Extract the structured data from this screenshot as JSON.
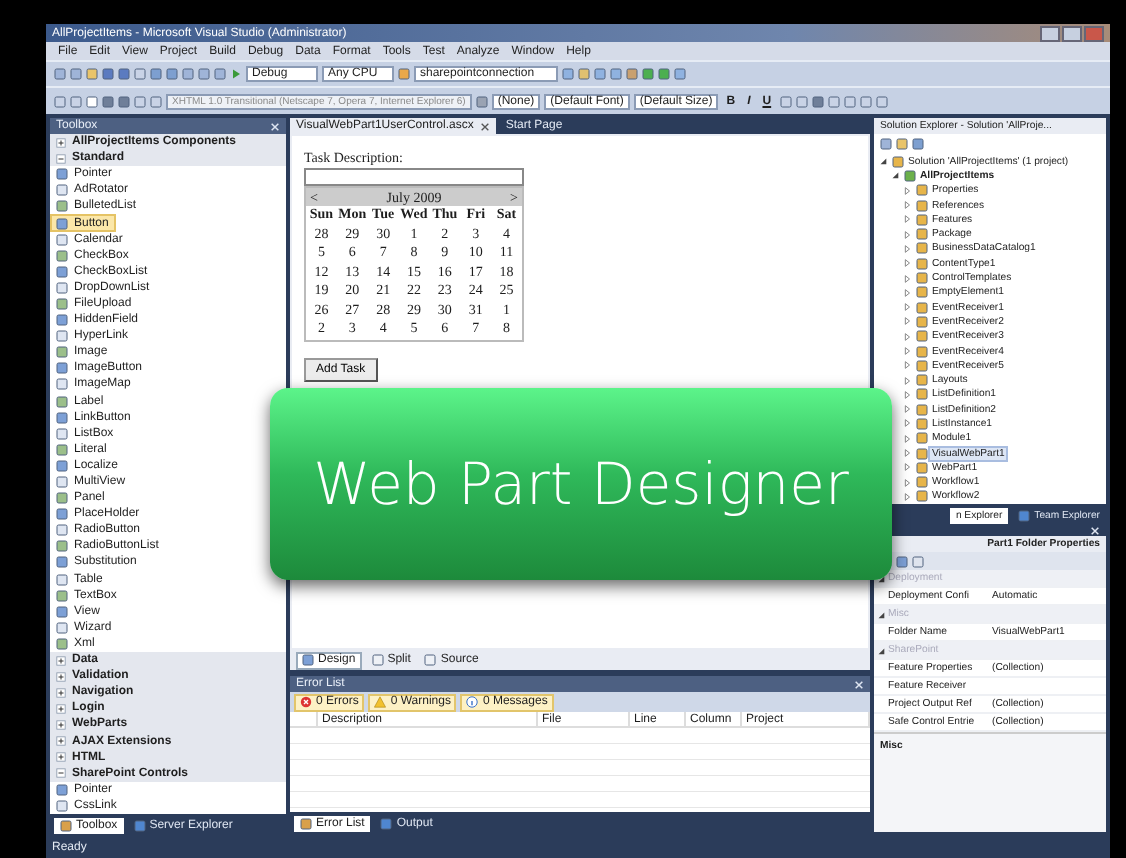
{
  "window": {
    "title": "AllProjectItems - Microsoft Visual Studio (Administrator)"
  },
  "menu": [
    "File",
    "Edit",
    "View",
    "Project",
    "Build",
    "Debug",
    "Data",
    "Format",
    "Tools",
    "Test",
    "Analyze",
    "Window",
    "Help"
  ],
  "toolbar": {
    "combos": [
      "Debug",
      "Any CPU",
      "sharepointconnection"
    ]
  },
  "format_toolbar": {
    "doctype": "XHTML 1.0 Transitional (Netscape 7, Opera 7, Internet Explorer 6)",
    "combos": [
      "(None)",
      "(Default Font)",
      "(Default Size)"
    ],
    "buttons": [
      "B",
      "I",
      "U"
    ]
  },
  "toolbox": {
    "title": "Toolbox",
    "groups": [
      {
        "label": "AllProjectItems Components",
        "expanded": false
      },
      {
        "label": "Standard",
        "expanded": true,
        "items": [
          {
            "label": "Pointer",
            "selected": false
          },
          {
            "label": "AdRotator",
            "selected": false
          },
          {
            "label": "BulletedList",
            "selected": false
          },
          {
            "label": "Button",
            "selected": true
          },
          {
            "label": "Calendar",
            "selected": false
          },
          {
            "label": "CheckBox",
            "selected": false
          },
          {
            "label": "CheckBoxList",
            "selected": false
          },
          {
            "label": "DropDownList",
            "selected": false
          },
          {
            "label": "FileUpload",
            "selected": false
          },
          {
            "label": "HiddenField",
            "selected": false
          },
          {
            "label": "HyperLink",
            "selected": false
          },
          {
            "label": "Image",
            "selected": false
          },
          {
            "label": "ImageButton",
            "selected": false
          },
          {
            "label": "ImageMap",
            "selected": false
          },
          {
            "label": "Label",
            "selected": false
          },
          {
            "label": "LinkButton",
            "selected": false
          },
          {
            "label": "ListBox",
            "selected": false
          },
          {
            "label": "Literal",
            "selected": false
          },
          {
            "label": "Localize",
            "selected": false
          },
          {
            "label": "MultiView",
            "selected": false
          },
          {
            "label": "Panel",
            "selected": false
          },
          {
            "label": "PlaceHolder",
            "selected": false
          },
          {
            "label": "RadioButton",
            "selected": false
          },
          {
            "label": "RadioButtonList",
            "selected": false
          },
          {
            "label": "Substitution",
            "selected": false
          },
          {
            "label": "Table",
            "selected": false
          },
          {
            "label": "TextBox",
            "selected": false
          },
          {
            "label": "View",
            "selected": false
          },
          {
            "label": "Wizard",
            "selected": false
          },
          {
            "label": "Xml",
            "selected": false
          }
        ]
      },
      {
        "label": "Data",
        "expanded": false
      },
      {
        "label": "Validation",
        "expanded": false
      },
      {
        "label": "Navigation",
        "expanded": false
      },
      {
        "label": "Login",
        "expanded": false
      },
      {
        "label": "WebParts",
        "expanded": false
      },
      {
        "label": "AJAX Extensions",
        "expanded": false
      },
      {
        "label": "HTML",
        "expanded": false
      },
      {
        "label": "SharePoint Controls",
        "expanded": true,
        "items": [
          {
            "label": "Pointer",
            "selected": false
          },
          {
            "label": "CssLink",
            "selected": false
          }
        ]
      }
    ],
    "tabs": [
      {
        "label": "Toolbox",
        "selected": true
      },
      {
        "label": "Server Explorer",
        "selected": false
      }
    ]
  },
  "document_tabs": [
    {
      "label": "VisualWebPart1UserControl.ascx",
      "selected": true
    },
    {
      "label": "Start Page",
      "selected": false
    }
  ],
  "designer": {
    "label": "Task Description:",
    "calendar": {
      "prev": "<",
      "month": "July 2009",
      "next": ">",
      "weekdays": [
        "Sun",
        "Mon",
        "Tue",
        "Wed",
        "Thu",
        "Fri",
        "Sat"
      ],
      "weeks": [
        [
          "28",
          "29",
          "30",
          "1",
          "2",
          "3",
          "4"
        ],
        [
          "5",
          "6",
          "7",
          "8",
          "9",
          "10",
          "11"
        ],
        [
          "12",
          "13",
          "14",
          "15",
          "16",
          "17",
          "18"
        ],
        [
          "19",
          "20",
          "21",
          "22",
          "23",
          "24",
          "25"
        ],
        [
          "26",
          "27",
          "28",
          "29",
          "30",
          "31",
          "1"
        ],
        [
          "2",
          "3",
          "4",
          "5",
          "6",
          "7",
          "8"
        ]
      ]
    },
    "button": "Add Task"
  },
  "view_tabs": [
    {
      "label": "Design",
      "selected": true
    },
    {
      "label": "Split",
      "selected": false
    },
    {
      "label": "Source",
      "selected": false
    }
  ],
  "error_list": {
    "title": "Error List",
    "filters": [
      {
        "kind": "error",
        "label": "0 Errors"
      },
      {
        "kind": "warning",
        "label": "0 Warnings"
      },
      {
        "kind": "info",
        "label": "0 Messages"
      }
    ],
    "columns": [
      "Description",
      "File",
      "Line",
      "Column",
      "Project"
    ],
    "tabs": [
      {
        "label": "Error List",
        "selected": true
      },
      {
        "label": "Output",
        "selected": false
      }
    ]
  },
  "solution_explorer": {
    "title": "Solution Explorer - Solution 'AllProje...",
    "tree": [
      {
        "label": "Solution 'AllProjectItems' (1 project)",
        "selected": false,
        "expanded": true,
        "children": [
          {
            "label": "AllProjectItems",
            "selected": false,
            "expanded": true,
            "children": [
              {
                "label": "Properties",
                "selected": false,
                "expanded": false
              },
              {
                "label": "References",
                "selected": false,
                "expanded": false
              },
              {
                "label": "Features",
                "selected": false,
                "expanded": false
              },
              {
                "label": "Package",
                "selected": false,
                "expanded": false
              },
              {
                "label": "BusinessDataCatalog1",
                "selected": false,
                "expanded": false
              },
              {
                "label": "ContentType1",
                "selected": false,
                "expanded": false
              },
              {
                "label": "ControlTemplates",
                "selected": false,
                "expanded": false
              },
              {
                "label": "EmptyElement1",
                "selected": false,
                "expanded": false
              },
              {
                "label": "EventReceiver1",
                "selected": false,
                "expanded": false
              },
              {
                "label": "EventReceiver2",
                "selected": false,
                "expanded": false
              },
              {
                "label": "EventReceiver3",
                "selected": false,
                "expanded": false
              },
              {
                "label": "EventReceiver4",
                "selected": false,
                "expanded": false
              },
              {
                "label": "EventReceiver5",
                "selected": false,
                "expanded": false
              },
              {
                "label": "Layouts",
                "selected": false,
                "expanded": false
              },
              {
                "label": "ListDefinition1",
                "selected": false,
                "expanded": false
              },
              {
                "label": "ListDefinition2",
                "selected": false,
                "expanded": false
              },
              {
                "label": "ListInstance1",
                "selected": false,
                "expanded": false
              },
              {
                "label": "Module1",
                "selected": false,
                "expanded": false
              },
              {
                "label": "VisualWebPart1",
                "selected": true,
                "expanded": false
              },
              {
                "label": "WebPart1",
                "selected": false,
                "expanded": false
              },
              {
                "label": "Workflow1",
                "selected": false,
                "expanded": false
              },
              {
                "label": "Workflow2",
                "selected": false,
                "expanded": false
              }
            ]
          }
        ]
      }
    ],
    "tabs": [
      {
        "label": "n Explorer",
        "selected": true
      },
      {
        "label": "Team Explorer",
        "selected": false
      }
    ]
  },
  "properties": {
    "title": "Part1 Folder Properties",
    "rows": [
      {
        "kind": "category",
        "name": "Deployment"
      },
      {
        "kind": "property",
        "name": "Deployment Confi",
        "value": "Automatic"
      },
      {
        "kind": "category",
        "name": "Misc"
      },
      {
        "kind": "property",
        "name": "Folder Name",
        "value": "VisualWebPart1"
      },
      {
        "kind": "category",
        "name": "SharePoint"
      },
      {
        "kind": "property",
        "name": "Feature Properties",
        "value": "(Collection)"
      },
      {
        "kind": "property",
        "name": "Feature Receiver",
        "value": ""
      },
      {
        "kind": "property",
        "name": "Project Output Ref",
        "value": "(Collection)"
      },
      {
        "kind": "property",
        "name": "Safe Control Entrie",
        "value": "(Collection)"
      }
    ],
    "description": "Misc"
  },
  "status_bar": "Ready",
  "banner": "Web Part Designer"
}
